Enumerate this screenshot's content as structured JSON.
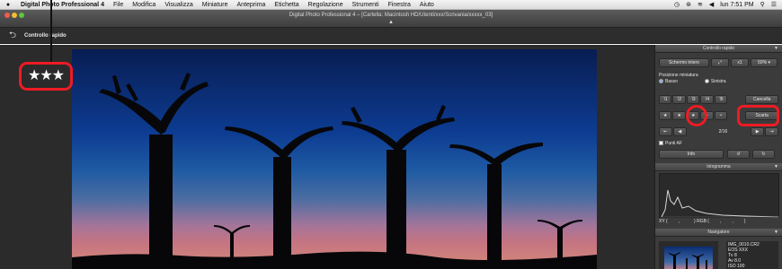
{
  "menubar": {
    "apple_icon": "apple-icon",
    "app_name": "Digital Photo Professional 4",
    "items": [
      "File",
      "Modifica",
      "Visualizza",
      "Miniature",
      "Anteprima",
      "Etichetta",
      "Regolazione",
      "Strumenti",
      "Finestra",
      "Aiuto"
    ],
    "status_icons": [
      "time-machine-icon",
      "bluetooth-icon",
      "wifi-icon",
      "volume-icon"
    ],
    "clock": "lun 7:51 PM",
    "spotlight_icon": "search-icon",
    "list_icon": "notification-list-icon"
  },
  "window": {
    "title": "Digital Photo Professional 4 – [Cartella: Macintosh HD/Utenti/xxx/Scrivania/xxxxx_03]"
  },
  "toolbar": {
    "back_icon": "⮌",
    "title": "Controllo rapido"
  },
  "viewer": {
    "rating_stars": "★★★",
    "rating_value": 3
  },
  "panel": {
    "header": "Controllo rapido",
    "screen_button": "Schermo intero",
    "fit_icon": "⤢",
    "zoom_button": "x1",
    "zoom_select": "50%",
    "thumbnail_position_label": "Posizione miniatura",
    "radio_bottom": "Basso",
    "radio_left": "Sinistra",
    "check_marks": [
      "˥1",
      "˥2",
      "˥3",
      "˥4",
      "˥5"
    ],
    "clear_button": "Cancella",
    "rating_buttons": [
      "★",
      "★",
      "★",
      "•",
      "•"
    ],
    "reject_button": "Scarta",
    "first_icon": "⇤",
    "prev_icon": "◀",
    "counter": "2/16",
    "next_icon": "▶",
    "last_icon": "⇥",
    "af_points_label": "Punti AF",
    "info_button": "Info",
    "histogram_header": "Istogramma",
    "readout_xy": "XY (",
    "readout_sep1": ",",
    "readout_rgb": ") RGB (",
    "readout_sep2": ",",
    "readout_sep3": ",",
    "readout_end": ")",
    "navigator_header": "Navigatore",
    "file_info": [
      "IMG_0010.CR2",
      "EOS XXX",
      "Tv 8",
      "Av 8.0",
      "ISO 100"
    ]
  }
}
